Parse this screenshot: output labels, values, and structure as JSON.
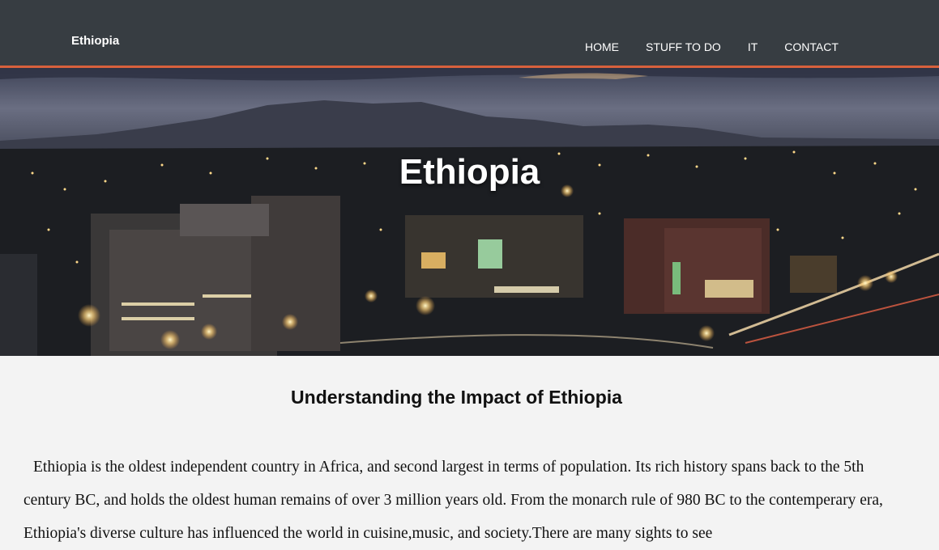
{
  "navbar": {
    "brand": "Ethiopia",
    "links": [
      "HOME",
      "STUFF TO DO",
      "IT",
      "CONTACT"
    ],
    "accent_color": "#d8613c",
    "background_color": "#373d42"
  },
  "hero": {
    "title": "Ethiopia",
    "image_description_icon": "city-night-photo"
  },
  "main": {
    "heading": "Understanding the Impact of Ethiopia",
    "paragraph": "Ethiopia is the oldest independent country in Africa, and second largest in terms of population. Its rich history spans back to the 5th century BC, and holds the oldest human remains of over 3 million years old. From the monarch rule of 980 BC to the contemperary era, Ethiopia's diverse culture has influenced the world in cuisine,music, and society.There are many sights to see"
  }
}
